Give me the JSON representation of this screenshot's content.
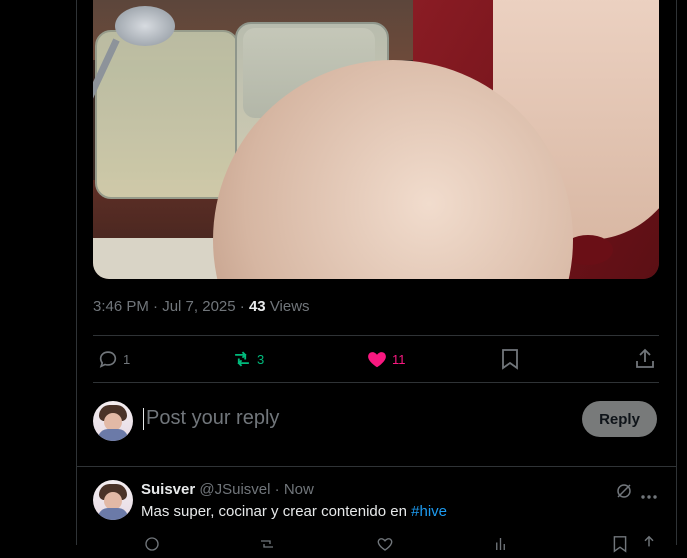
{
  "tweet": {
    "time": "3:46 PM",
    "date": "Jul 7, 2025",
    "views_count": "43",
    "views_label": "Views",
    "separator": "·",
    "actions": {
      "replies": "1",
      "reposts": "3",
      "likes": "11"
    }
  },
  "composer": {
    "placeholder": "Post your reply",
    "reply_button": "Reply"
  },
  "reply": {
    "display_name": "Suisver",
    "handle": "@JSuisvel",
    "time": "Now",
    "text": "Mas super, cocinar y crear contenido en ",
    "hashtag": "#hive"
  },
  "colors": {
    "background": "#000000",
    "border": "#2f3336",
    "muted_text": "#71767b",
    "repost_green": "#00ba7c",
    "like_pink": "#f91880",
    "link_blue": "#1d9bf0",
    "reply_button_bg": "#787a7a"
  },
  "icons": {
    "reply": "reply-icon",
    "repost": "repost-icon",
    "like": "heart-filled-icon",
    "bookmark": "bookmark-icon",
    "share": "share-icon",
    "grok": "grok-icon",
    "more": "more-icon"
  }
}
